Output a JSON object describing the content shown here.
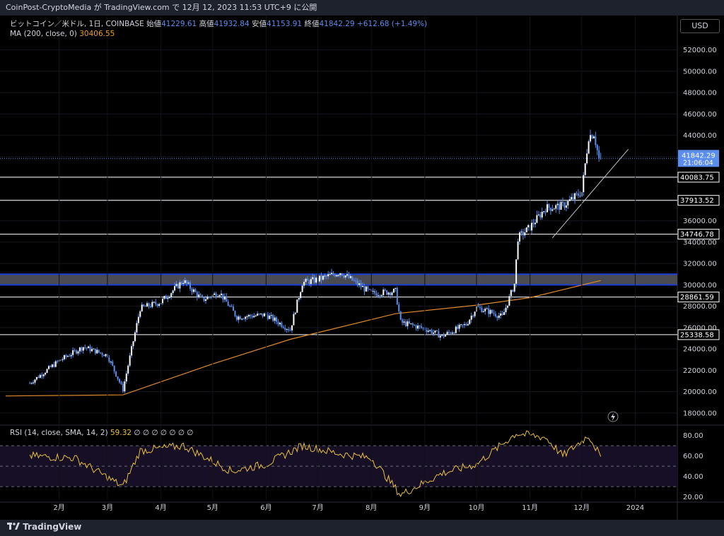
{
  "header": {
    "caption": "CoinPost-CryptoMedia が TradingView.com で 12月 12, 2023 11:53 UTC+9 に公開"
  },
  "legend": {
    "symbol": "ビットコイン／米ドル, 1日, COINBASE",
    "open_label": "始値",
    "open": "41229.61",
    "high_label": "高値",
    "high": "41932.84",
    "low_label": "安値",
    "low": "41153.91",
    "close_label": "終値",
    "close": "41842.29",
    "change": "+612.68 (+1.49%)",
    "ma_label": "MA (200, close, 0)",
    "ma_value": "30406.55"
  },
  "currency_button": "USD",
  "rsi_legend": {
    "label": "RSI (14, close, SMA, 14, 2)",
    "value": "59.32",
    "placeholders": "∅ ∅ ∅ ∅ ∅ ∅ ∅"
  },
  "footer": {
    "logo_text": "TradingView"
  },
  "colors": {
    "candle": "#5b8def",
    "ma": "#e08a2a",
    "rsi": "#e8c040",
    "band": "#1a3fd4",
    "hline": "#ffffff"
  },
  "chart_data": [
    {
      "type": "line",
      "title": "ビットコイン／米ドル, 1日, COINBASE",
      "x_ticks": [
        "2月",
        "3月",
        "4月",
        "5月",
        "6月",
        "7月",
        "8月",
        "9月",
        "10月",
        "11月",
        "12月",
        "2024"
      ],
      "y_ticks": [
        "18000.00",
        "20000.00",
        "22000.00",
        "24000.00",
        "26000.00",
        "28000.00",
        "30000.00",
        "32000.00",
        "34000.00",
        "36000.00",
        "38000.00",
        "40000.00",
        "42000.00",
        "44000.00",
        "46000.00",
        "48000.00",
        "50000.00",
        "52000.00"
      ],
      "ylim": [
        17000,
        53500
      ],
      "series": [
        {
          "name": "ビットコイン／米ドル",
          "x": [
            "2023-01-15",
            "2023-02-01",
            "2023-02-15",
            "2023-03-01",
            "2023-03-10",
            "2023-03-20",
            "2023-04-01",
            "2023-04-14",
            "2023-04-25",
            "2023-05-05",
            "2023-05-15",
            "2023-06-01",
            "2023-06-15",
            "2023-06-22",
            "2023-07-01",
            "2023-07-14",
            "2023-08-01",
            "2023-08-15",
            "2023-08-18",
            "2023-09-01",
            "2023-09-11",
            "2023-09-25",
            "2023-10-01",
            "2023-10-10",
            "2023-10-16",
            "2023-10-23",
            "2023-10-25",
            "2023-11-01",
            "2023-11-10",
            "2023-11-20",
            "2023-12-01",
            "2023-12-05",
            "2023-12-08",
            "2023-12-11",
            "2023-12-12"
          ],
          "values": [
            20800,
            22900,
            24200,
            23400,
            20200,
            27800,
            28400,
            30400,
            28600,
            29300,
            27000,
            27200,
            25800,
            30200,
            30500,
            31200,
            29200,
            29400,
            26500,
            25900,
            25200,
            26300,
            27900,
            27400,
            27000,
            30100,
            34400,
            35400,
            37200,
            37400,
            38700,
            43900,
            44200,
            41800,
            41842
          ]
        }
      ],
      "ma_200": {
        "name": "MA (200, close, 0)",
        "x": [
          "2023-01-01",
          "2023-03-10",
          "2023-05-01",
          "2023-06-15",
          "2023-08-15",
          "2023-10-01",
          "2023-11-01",
          "2023-12-12"
        ],
        "values": [
          19600,
          19700,
          22600,
          24900,
          27300,
          28100,
          28800,
          30406.55
        ]
      },
      "levels": [
        {
          "label": "40083.75",
          "value": 40083.75
        },
        {
          "label": "37913.52",
          "value": 37913.52
        },
        {
          "label": "34746.78",
          "value": 34746.78
        },
        {
          "label": "28861.59",
          "value": 28861.59
        },
        {
          "label": "25338.58",
          "value": 25338.58
        }
      ],
      "band": [
        30000,
        31000
      ],
      "trendline": {
        "x": [
          "2023-11-14",
          "2023-12-28"
        ],
        "values": [
          34400,
          42700
        ]
      },
      "last_price": {
        "label": "41842.29",
        "countdown": "21:06:04"
      }
    },
    {
      "type": "line",
      "title": "RSI (14, close, SMA, 14, 2)",
      "y_ticks": [
        "20.00",
        "40.00",
        "60.00",
        "80.00"
      ],
      "ylim": [
        17,
        88
      ],
      "guides": [
        70,
        50,
        30
      ],
      "series": [
        {
          "name": "RSI",
          "x": [
            "2023-01-15",
            "2023-02-10",
            "2023-03-10",
            "2023-03-20",
            "2023-04-14",
            "2023-05-12",
            "2023-06-01",
            "2023-06-22",
            "2023-07-14",
            "2023-08-01",
            "2023-08-18",
            "2023-09-11",
            "2023-10-01",
            "2023-10-24",
            "2023-11-10",
            "2023-11-20",
            "2023-12-05",
            "2023-12-12"
          ],
          "values": [
            60,
            58,
            30,
            65,
            70,
            45,
            52,
            70,
            62,
            58,
            22,
            43,
            52,
            82,
            78,
            60,
            80,
            59.32
          ]
        }
      ]
    }
  ]
}
